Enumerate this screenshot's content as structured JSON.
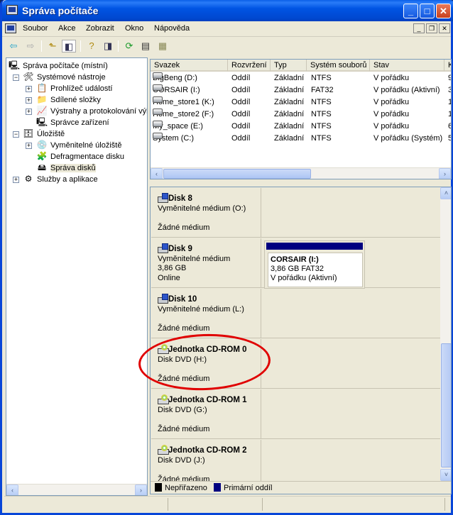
{
  "window": {
    "title": "Správa počítače",
    "minimize": "_",
    "maximize": "□",
    "close": "✕"
  },
  "menu": [
    "Soubor",
    "Akce",
    "Zobrazit",
    "Okno",
    "Nápověda"
  ],
  "toolbar_icons": [
    "back-arrow-icon",
    "forward-arrow-icon",
    "up-folder-icon",
    "show-hide-tree-icon",
    "help-icon",
    "show-hide-action-pane-icon",
    "refresh-icon",
    "properties-icon",
    "export-icon"
  ],
  "tree": {
    "root": "Správa počítače (místní)",
    "system_tools": "Systémové nástroje",
    "event_viewer": "Prohlížeč událostí",
    "shared_folders": "Sdílené složky",
    "alerts": "Výstrahy a protokolování výkonu",
    "device_manager": "Správce zařízení",
    "storage": "Úložiště",
    "removable_storage": "Vyměnitelné úložiště",
    "defrag": "Defragmentace disku",
    "disk_management": "Správa disků",
    "services": "Služby a aplikace"
  },
  "volumes": {
    "columns": [
      "Svazek",
      "Rozvržení",
      "Typ",
      "Systém souborů",
      "Stav",
      "K"
    ],
    "rows": [
      {
        "name": "BigBeng (D:)",
        "layout": "Oddíl",
        "type": "Základní",
        "fs": "NTFS",
        "status": "V pořádku",
        "cap": "9"
      },
      {
        "name": "CORSAIR (I:)",
        "layout": "Oddíl",
        "type": "Základní",
        "fs": "FAT32",
        "status": "V pořádku (Aktivní)",
        "cap": "3"
      },
      {
        "name": "Home_store1 (K:)",
        "layout": "Oddíl",
        "type": "Základní",
        "fs": "NTFS",
        "status": "V pořádku",
        "cap": "1"
      },
      {
        "name": "Home_store2 (F:)",
        "layout": "Oddíl",
        "type": "Základní",
        "fs": "NTFS",
        "status": "V pořádku",
        "cap": "1"
      },
      {
        "name": "My_space (E:)",
        "layout": "Oddíl",
        "type": "Základní",
        "fs": "NTFS",
        "status": "V pořádku",
        "cap": "6"
      },
      {
        "name": "System (C:)",
        "layout": "Oddíl",
        "type": "Základní",
        "fs": "NTFS",
        "status": "V pořádku (Systém)",
        "cap": "5"
      }
    ]
  },
  "disks": [
    {
      "name": "Disk 8",
      "l1": "Vyměnitelné médium (O:)",
      "l2": "",
      "l3": "Žádné médium"
    },
    {
      "name": "Disk 9",
      "l1": "Vyměnitelné médium",
      "l2": "3,86 GB",
      "l3": "Online",
      "partition": {
        "name": "CORSAIR  (I:)",
        "size": "3,86 GB FAT32",
        "status": "V pořádku (Aktivní)"
      }
    },
    {
      "name": "Disk 10",
      "l1": "Vyměnitelné médium (L:)",
      "l2": "",
      "l3": "Žádné médium"
    },
    {
      "name": "Jednotka CD-ROM 0",
      "l1": "Disk DVD (H:)",
      "l2": "",
      "l3": "Žádné médium"
    },
    {
      "name": "Jednotka CD-ROM 1",
      "l1": "Disk DVD (G:)",
      "l2": "",
      "l3": "Žádné médium"
    },
    {
      "name": "Jednotka CD-ROM 2",
      "l1": "Disk DVD (J:)",
      "l2": "",
      "l3": "Žádné médium"
    }
  ],
  "legend": {
    "unallocated": "Nepřiřazeno",
    "primary": "Primární oddíl",
    "unallocated_color": "#000000",
    "primary_color": "#000080"
  },
  "scroll_arrows": {
    "left": "‹",
    "right": "›",
    "up": "˄",
    "down": "˅"
  }
}
